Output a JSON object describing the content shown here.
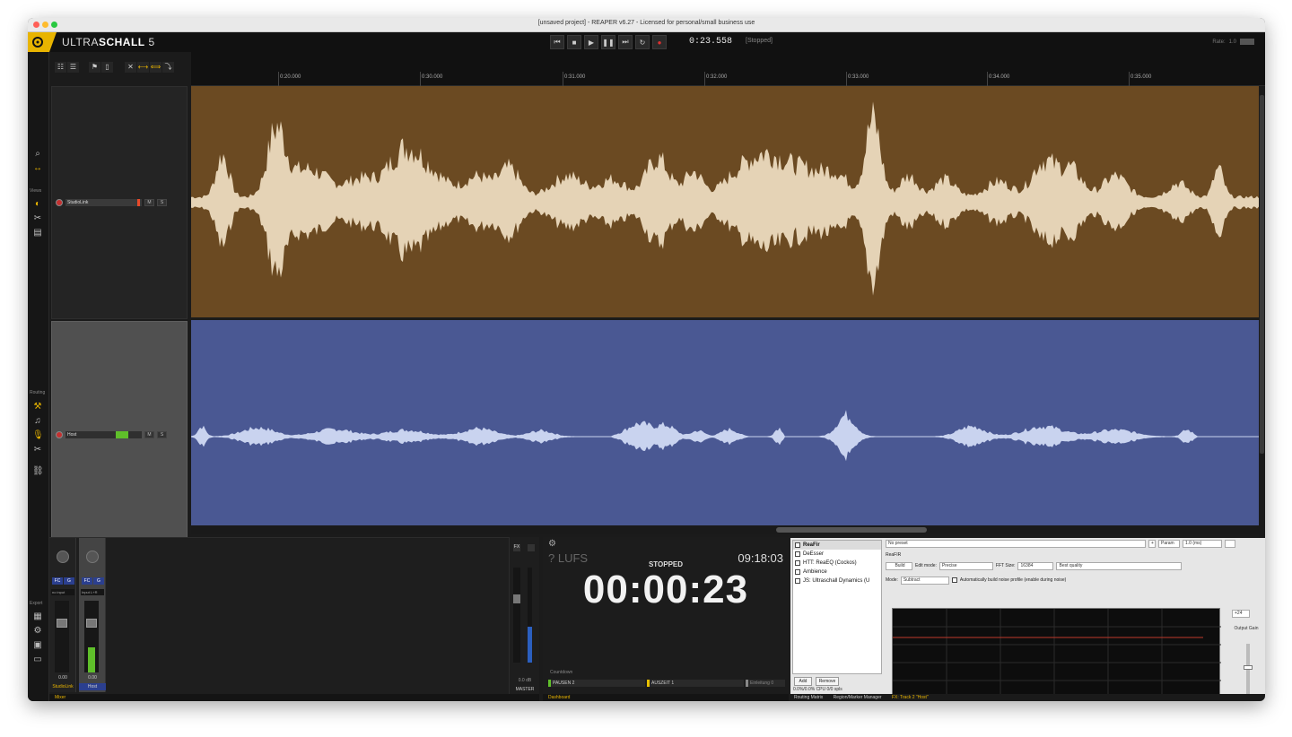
{
  "window": {
    "title": "[unsaved project] - REAPER v6.27 - Licensed for personal/small business use"
  },
  "topbar": {
    "brand_light": "ULTRA",
    "brand_bold": "SCHALL",
    "brand_version": "5",
    "time": "0:23.558",
    "state": "[Stopped]",
    "rate_label": "Rate:",
    "rate_value": "1.0"
  },
  "transport_buttons": [
    "skip-start",
    "stop",
    "play",
    "pause",
    "skip-end",
    "repeat",
    "record"
  ],
  "left_strip": {
    "views_label": "Views",
    "routing_label": "Routing",
    "export_label": "Export"
  },
  "ruler": {
    "ticks": [
      "0:20.000",
      "0:30.000",
      "0:31.000",
      "0:32.000",
      "0:33.000",
      "0:34.000",
      "0:35.000"
    ]
  },
  "tracks": [
    {
      "name": "StudioLink",
      "color": "#6b4a22",
      "wave_color": "#e5d3b6"
    },
    {
      "name": "Host",
      "color": "#4a5893",
      "wave_color": "#c9d3ef"
    }
  ],
  "mixer": {
    "strips": [
      {
        "name": "StudioLink",
        "fx1": "FC",
        "fx2": "G",
        "io": "no input",
        "volume": "0.00",
        "name_color": "#e8b400"
      },
      {
        "name": "Host",
        "fx1": "FC",
        "fx2": "G",
        "io": "Input L+R",
        "volume": "0.00",
        "name_color": "#cfcfcf"
      }
    ],
    "master_label": "MASTER",
    "master_volume": "0.0 dB",
    "footer_label": "Mixer"
  },
  "dashboard": {
    "lufs": "? LUFS",
    "clock": "09:18:03",
    "state": "STOPPED",
    "time": "00:00:23",
    "countdown_label": "Countdown",
    "markers": [
      {
        "label": "PAUSEN 2",
        "color": "#5fbf2a"
      },
      {
        "label": "AUSZEIT 1",
        "color": "#e8c000"
      },
      {
        "label": "Einleitung 0",
        "color": "#888888"
      }
    ],
    "footer_label": "Dashboard"
  },
  "fx": {
    "chain": [
      "ReaFir",
      "DeEsser",
      "HTT: ReaEQ (Cockos)",
      "Ambience",
      "JS: Ultraschall Dynamics (U"
    ],
    "add": "Add",
    "remove": "Remove",
    "cpu": "0.0%/0.0% CPU 0/0 spls",
    "preset": "No preset",
    "param_label": "Param",
    "wet": "1.0 (ms)",
    "edit_label": "Edit mode:",
    "edit_value": "Precise",
    "fft_label": "FFT Size:",
    "fft_value": "16384",
    "quality": "Best quality",
    "mode_label": "Mode:",
    "mode_value": "Subtract",
    "auto_build": "Automatically build noise profile (enable during noise)",
    "build_btn": "Build",
    "output_label": "Output Gain",
    "level": "+24",
    "status_1": "Routing Matrix",
    "status_2": "Region/Marker Manager",
    "status_3": "FX: Track 2 \"Host\""
  }
}
